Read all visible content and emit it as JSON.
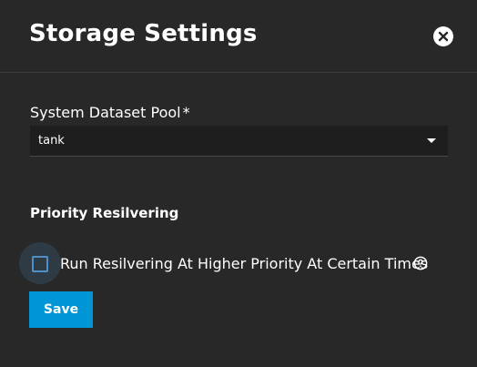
{
  "dialog": {
    "title": "Storage Settings",
    "close_icon": "close-circle-icon"
  },
  "system_dataset_pool": {
    "label": "System Dataset Pool",
    "required_mark": "*",
    "selected_value": "tank",
    "caret_icon": "dropdown-caret-icon"
  },
  "priority_resilvering": {
    "section_title": "Priority Resilvering",
    "checkbox_label": "Run Resilvering At Higher Priority At Certain Times",
    "checked": false,
    "help_icon": "help-circle-icon"
  },
  "actions": {
    "save_label": "Save"
  },
  "colors": {
    "background": "#282828",
    "accent": "#0095d5",
    "checkbox_border": "#4f8fc8",
    "select_background": "#1e1e1e"
  }
}
